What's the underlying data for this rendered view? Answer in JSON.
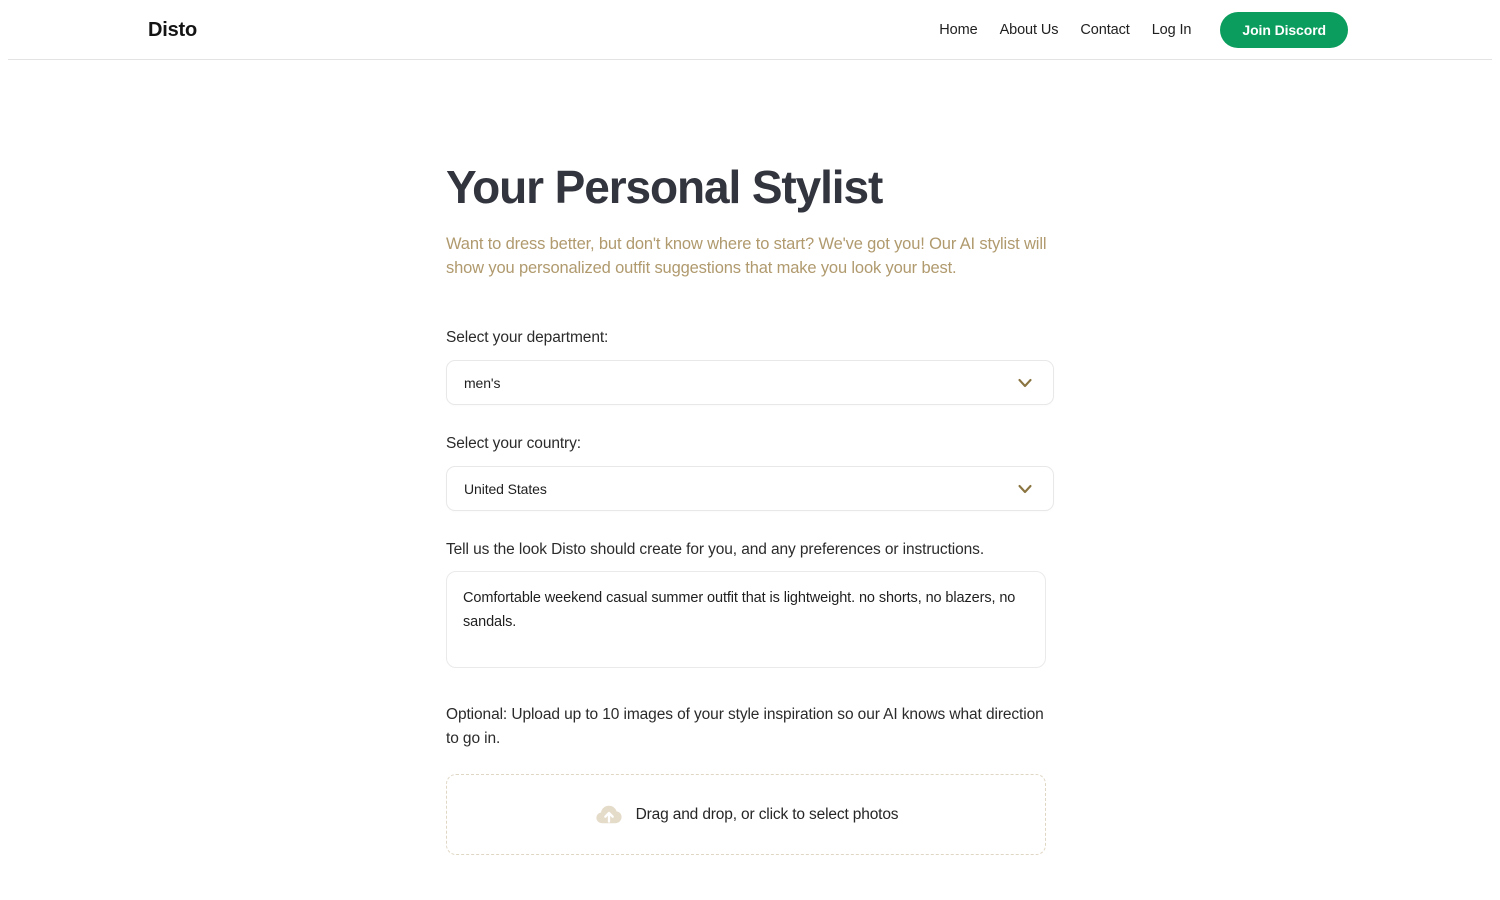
{
  "header": {
    "brand": "Disto",
    "nav_links": [
      {
        "label": "Home"
      },
      {
        "label": "About Us"
      },
      {
        "label": "Contact"
      },
      {
        "label": "Log In"
      }
    ],
    "cta": {
      "label": "Join Discord",
      "color": "#0a9d5e"
    }
  },
  "main": {
    "title": "Your Personal Stylist",
    "subtitle": "Want to dress better, but don't know where to start? We've got you! Our AI stylist will show you personalized outfit suggestions that make you look your best.",
    "subtitle_color": "#b09a6e",
    "title_color": "#32343e",
    "department": {
      "label": "Select your department:",
      "value": "men's",
      "icon": "chevron-down-icon",
      "icon_color": "#8a7440"
    },
    "country": {
      "label": "Select your country:",
      "value": "United States",
      "icon": "chevron-down-icon",
      "icon_color": "#8a7440"
    },
    "prompt": {
      "label": "Tell us the look Disto should create for you, and any preferences or instructions.",
      "value": "Comfortable weekend casual summer outfit that is lightweight. no shorts, no blazers, no sandals.",
      "placeholder": ""
    },
    "upload": {
      "label": "Optional: Upload up to 10 images of your style inspiration so our AI knows what direction to go in.",
      "dropzone_text": "Drag and drop, or click to select photos",
      "icon": "cloud-upload-icon",
      "icon_color": "#e5dbc9"
    }
  }
}
